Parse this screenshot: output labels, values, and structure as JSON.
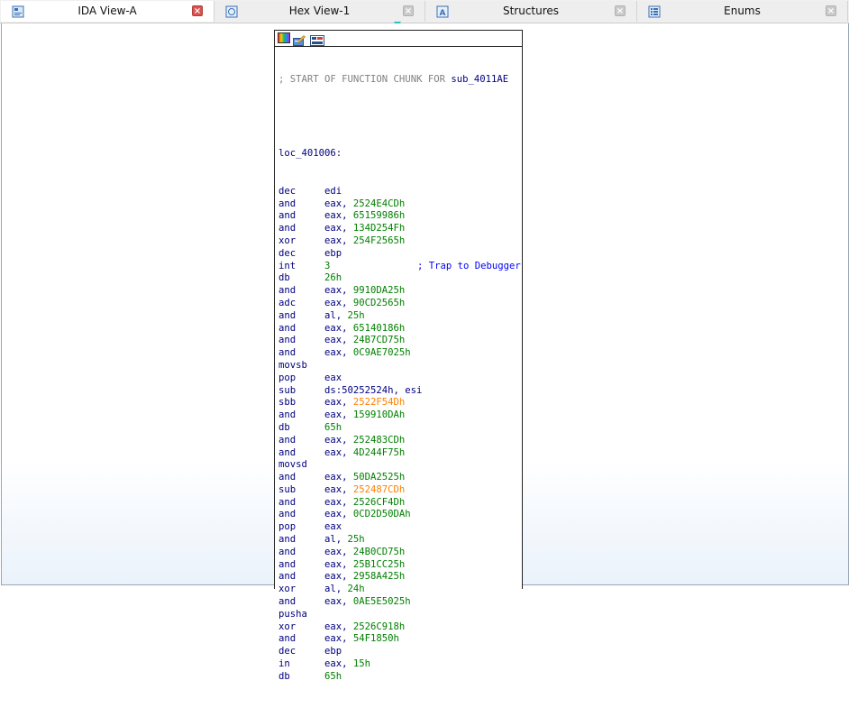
{
  "tabs": [
    {
      "label": "IDA View-A",
      "icon": "ida-view-icon",
      "active": true,
      "close": "red"
    },
    {
      "label": "Hex View-1",
      "icon": "hex-view-icon",
      "active": false,
      "close": "gray"
    },
    {
      "label": "Structures",
      "icon": "structures-icon",
      "active": false,
      "close": "gray"
    },
    {
      "label": "Enums",
      "icon": "enums-icon",
      "active": false,
      "close": "gray"
    }
  ],
  "close_glyph": "×",
  "node": {
    "header_comment": "; START OF FUNCTION CHUNK FOR ",
    "header_name": "sub_4011AE",
    "label": "loc_401006:",
    "lines": [
      {
        "m": "dec",
        "a": "edi"
      },
      {
        "m": "and",
        "a": "eax, ",
        "n": "2524E4CDh"
      },
      {
        "m": "and",
        "a": "eax, ",
        "n": "65159986h"
      },
      {
        "m": "and",
        "a": "eax, ",
        "n": "134D254Fh"
      },
      {
        "m": "xor",
        "a": "eax, ",
        "n": "254F2565h"
      },
      {
        "m": "dec",
        "a": "ebp"
      },
      {
        "m": "int",
        "a": "",
        "n": "3",
        "c": "; Trap to Debugger"
      },
      {
        "m": "db",
        "a": "",
        "n": "26h"
      },
      {
        "m": "and",
        "a": "eax, ",
        "n": "9910DA25h"
      },
      {
        "m": "adc",
        "a": "eax, ",
        "n": "90CD2565h"
      },
      {
        "m": "and",
        "a": "al, ",
        "n": "25h"
      },
      {
        "m": "and",
        "a": "eax, ",
        "n": "65140186h"
      },
      {
        "m": "and",
        "a": "eax, ",
        "n": "24B7CD75h"
      },
      {
        "m": "and",
        "a": "eax, ",
        "n": "0C9AE7025h"
      },
      {
        "m": "movsb",
        "a": ""
      },
      {
        "m": "pop",
        "a": "eax"
      },
      {
        "m": "sub",
        "a": "ds:50252524h, esi"
      },
      {
        "m": "sbb",
        "a": "eax, ",
        "n": "2522F54Dh",
        "w": true
      },
      {
        "m": "and",
        "a": "eax, ",
        "n": "159910DAh"
      },
      {
        "m": "db",
        "a": "",
        "n": "65h"
      },
      {
        "m": "and",
        "a": "eax, ",
        "n": "252483CDh"
      },
      {
        "m": "and",
        "a": "eax, ",
        "n": "4D244F75h"
      },
      {
        "m": "movsd",
        "a": ""
      },
      {
        "m": "and",
        "a": "eax, ",
        "n": "50DA2525h"
      },
      {
        "m": "sub",
        "a": "eax, ",
        "n": "252487CDh",
        "w": true
      },
      {
        "m": "and",
        "a": "eax, ",
        "n": "2526CF4Dh"
      },
      {
        "m": "and",
        "a": "eax, ",
        "n": "0CD2D50DAh"
      },
      {
        "m": "pop",
        "a": "eax"
      },
      {
        "m": "and",
        "a": "al, ",
        "n": "25h"
      },
      {
        "m": "and",
        "a": "eax, ",
        "n": "24B0CD75h"
      },
      {
        "m": "and",
        "a": "eax, ",
        "n": "25B1CC25h"
      },
      {
        "m": "and",
        "a": "eax, ",
        "n": "2958A425h"
      },
      {
        "m": "xor",
        "a": "al, ",
        "n": "24h"
      },
      {
        "m": "and",
        "a": "eax, ",
        "n": "0AE5E5025h"
      },
      {
        "m": "pusha",
        "a": ""
      },
      {
        "m": "xor",
        "a": "eax, ",
        "n": "2526C918h"
      },
      {
        "m": "and",
        "a": "eax, ",
        "n": "54F1850h"
      },
      {
        "m": "dec",
        "a": "ebp"
      },
      {
        "m": "in",
        "a": "eax, ",
        "n": "15h"
      },
      {
        "m": "db",
        "a": "",
        "n": "65h"
      }
    ]
  },
  "colors": {
    "mnemonic": "#00007f",
    "number": "#008000",
    "number_warn": "#ff8000",
    "comment": "#0000ff",
    "header_comment": "#808080",
    "caret": "#22c3c8"
  }
}
